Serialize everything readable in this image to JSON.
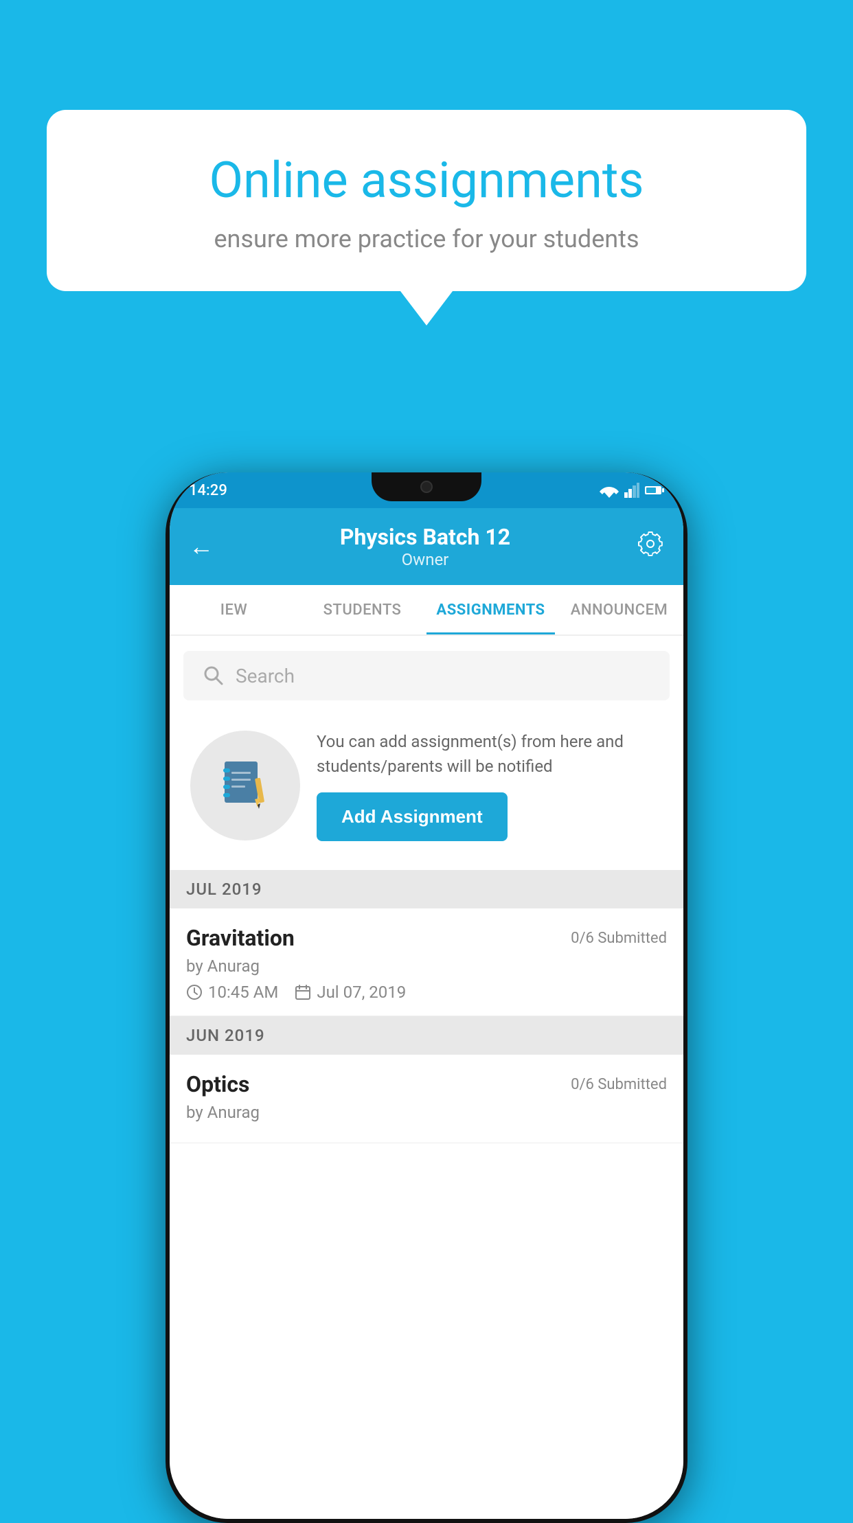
{
  "background": {
    "color": "#1ab8e8"
  },
  "speech_bubble": {
    "title": "Online assignments",
    "subtitle": "ensure more practice for your students"
  },
  "phone": {
    "status_bar": {
      "time": "14:29"
    },
    "app_bar": {
      "title": "Physics Batch 12",
      "subtitle": "Owner",
      "back_label": "←",
      "settings_label": "⚙"
    },
    "tabs": [
      {
        "label": "IEW",
        "active": false
      },
      {
        "label": "STUDENTS",
        "active": false
      },
      {
        "label": "ASSIGNMENTS",
        "active": true
      },
      {
        "label": "ANNOUNCEM",
        "active": false
      }
    ],
    "search": {
      "placeholder": "Search"
    },
    "promo": {
      "description": "You can add assignment(s) from here and students/parents will be notified",
      "button_label": "Add Assignment"
    },
    "sections": [
      {
        "label": "JUL 2019",
        "assignments": [
          {
            "title": "Gravitation",
            "submitted": "0/6 Submitted",
            "author": "by Anurag",
            "time": "10:45 AM",
            "date": "Jul 07, 2019"
          }
        ]
      },
      {
        "label": "JUN 2019",
        "assignments": [
          {
            "title": "Optics",
            "submitted": "0/6 Submitted",
            "author": "by Anurag",
            "time": "",
            "date": ""
          }
        ]
      }
    ]
  }
}
